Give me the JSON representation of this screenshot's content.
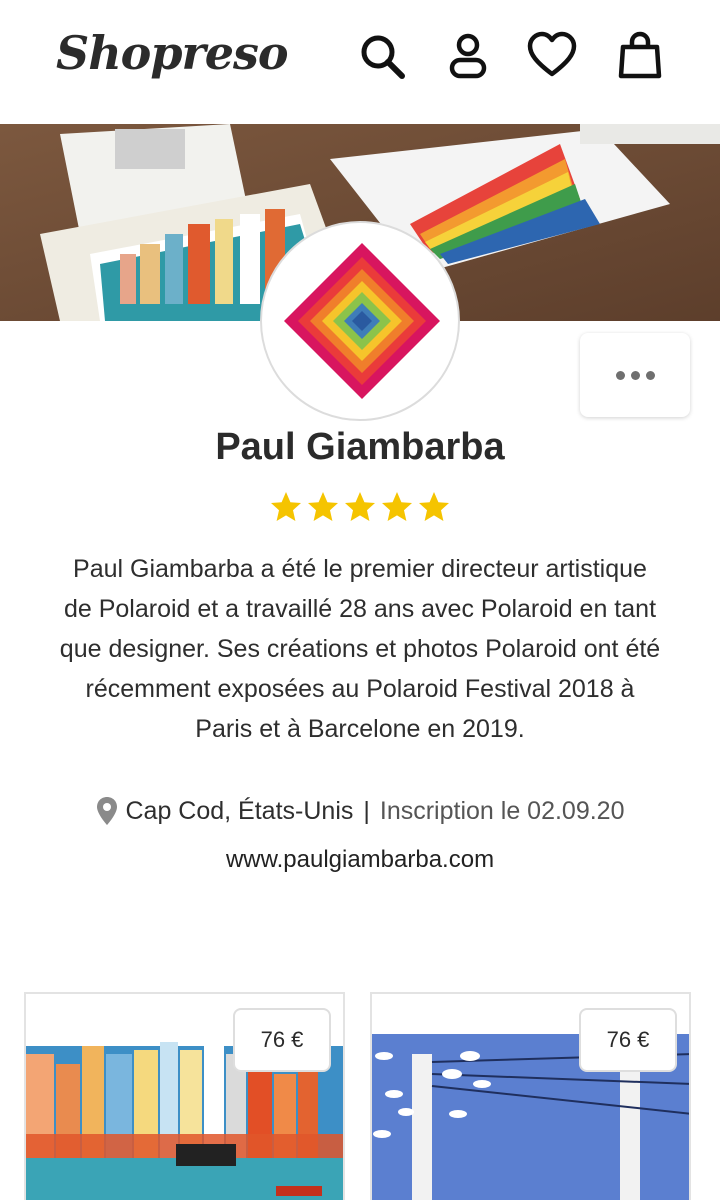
{
  "header": {
    "logo": "Shopreso",
    "icons": [
      "search-icon",
      "user-icon",
      "heart-icon",
      "bag-icon"
    ]
  },
  "profile": {
    "name": "Paul Giambarba",
    "rating": 5,
    "bio": "Paul Giambarba a été le premier directeur artistique de Polaroid et a travaillé 28 ans avec Polaroid en tant que designer. Ses créations et photos Polaroid ont été récemment exposées au Polaroid Festival 2018 à Paris et à Barcelone en 2019.",
    "location": "Cap Cod, États-Unis",
    "separator": "|",
    "joined": "Inscription le 02.09.20",
    "website": "www.paulgiambarba.com"
  },
  "products": [
    {
      "price": "76 €"
    },
    {
      "price": "76 €"
    }
  ],
  "colors": {
    "star": "#f5c400",
    "text": "#2b2b2b"
  }
}
